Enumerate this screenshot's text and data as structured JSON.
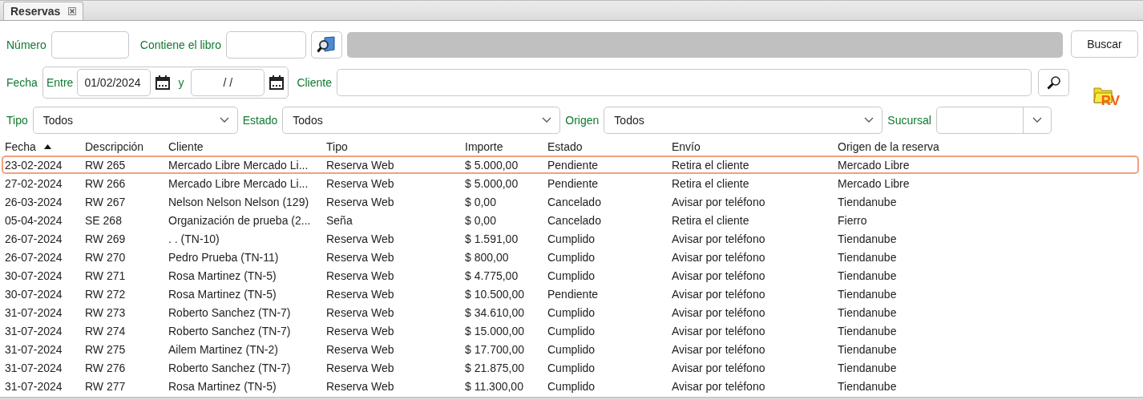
{
  "tabs": [
    {
      "label": "Reservas",
      "selected": true
    }
  ],
  "filters": {
    "numero": {
      "label": "Número"
    },
    "libro": {
      "label": "Contiene el libro"
    },
    "buscar": "Buscar",
    "fecha": {
      "label": "Fecha",
      "entre": "Entre",
      "desde": "01/02/2024",
      "y": "y",
      "hasta": "/ /"
    },
    "cliente": {
      "label": "Cliente"
    },
    "tipo": {
      "label": "Tipo",
      "value": "Todos"
    },
    "estado": {
      "label": "Estado",
      "value": "Todos"
    },
    "origen": {
      "label": "Origen",
      "value": "Todos"
    },
    "sucursal": {
      "label": "Sucursal"
    },
    "logo": "RV"
  },
  "table": {
    "columns": [
      {
        "label": "Fecha",
        "sorted": true
      },
      {
        "label": "Descripción",
        "sorted": false
      },
      {
        "label": "Cliente",
        "sorted": false
      },
      {
        "label": "Tipo",
        "sorted": false
      },
      {
        "label": "Importe",
        "sorted": false
      },
      {
        "label": "Estado",
        "sorted": false
      },
      {
        "label": "Envío",
        "sorted": false
      },
      {
        "label": "Origen de la reserva",
        "sorted": false
      }
    ],
    "rows": [
      {
        "selected": true,
        "cells": [
          "23-02-2024",
          "RW 265",
          "Mercado Libre Mercado Li...",
          "Reserva Web",
          "$ 5.000,00",
          "Pendiente",
          "Retira el cliente",
          "Mercado Libre"
        ]
      },
      {
        "selected": false,
        "cells": [
          "27-02-2024",
          "RW 266",
          "Mercado Libre Mercado Li...",
          "Reserva Web",
          "$ 5.000,00",
          "Pendiente",
          "Retira el cliente",
          "Mercado Libre"
        ]
      },
      {
        "selected": false,
        "cells": [
          "26-03-2024",
          "RW 267",
          "Nelson Nelson Nelson (129)",
          "Reserva Web",
          "$ 0,00",
          "Cancelado",
          "Avisar por teléfono",
          "Tiendanube"
        ]
      },
      {
        "selected": false,
        "cells": [
          "05-04-2024",
          "SE 268",
          "Organización de prueba (2...",
          "Seña",
          "$ 0,00",
          "Cancelado",
          "Retira el cliente",
          "Fierro"
        ]
      },
      {
        "selected": false,
        "cells": [
          "26-07-2024",
          "RW 269",
          ". . (TN-10)",
          "Reserva Web",
          "$ 1.591,00",
          "Cumplido",
          "Avisar por teléfono",
          "Tiendanube"
        ]
      },
      {
        "selected": false,
        "cells": [
          "26-07-2024",
          "RW 270",
          "Pedro Prueba (TN-11)",
          "Reserva Web",
          "$ 800,00",
          "Cumplido",
          "Avisar por teléfono",
          "Tiendanube"
        ]
      },
      {
        "selected": false,
        "cells": [
          "30-07-2024",
          "RW 271",
          "Rosa Martinez (TN-5)",
          "Reserva Web",
          "$ 4.775,00",
          "Cumplido",
          "Avisar por teléfono",
          "Tiendanube"
        ]
      },
      {
        "selected": false,
        "cells": [
          "30-07-2024",
          "RW 272",
          "Rosa Martinez (TN-5)",
          "Reserva Web",
          "$ 10.500,00",
          "Pendiente",
          "Avisar por teléfono",
          "Tiendanube"
        ]
      },
      {
        "selected": false,
        "cells": [
          "31-07-2024",
          "RW 273",
          "Roberto Sanchez (TN-7)",
          "Reserva Web",
          "$ 34.610,00",
          "Cumplido",
          "Avisar por teléfono",
          "Tiendanube"
        ]
      },
      {
        "selected": false,
        "cells": [
          "31-07-2024",
          "RW 274",
          "Roberto Sanchez (TN-7)",
          "Reserva Web",
          "$ 15.000,00",
          "Cumplido",
          "Avisar por teléfono",
          "Tiendanube"
        ]
      },
      {
        "selected": false,
        "cells": [
          "31-07-2024",
          "RW 275",
          "Ailem Martinez (TN-2)",
          "Reserva Web",
          "$ 17.700,00",
          "Cumplido",
          "Avisar por teléfono",
          "Tiendanube"
        ]
      },
      {
        "selected": false,
        "cells": [
          "31-07-2024",
          "RW 276",
          "Roberto Sanchez (TN-7)",
          "Reserva Web",
          "$ 21.875,00",
          "Cumplido",
          "Avisar por teléfono",
          "Tiendanube"
        ]
      },
      {
        "selected": false,
        "cells": [
          "31-07-2024",
          "RW 277",
          "Rosa Martinez (TN-5)",
          "Reserva Web",
          "$ 11.300,00",
          "Cumplido",
          "Avisar por teléfono",
          "Tiendanube"
        ]
      }
    ]
  }
}
